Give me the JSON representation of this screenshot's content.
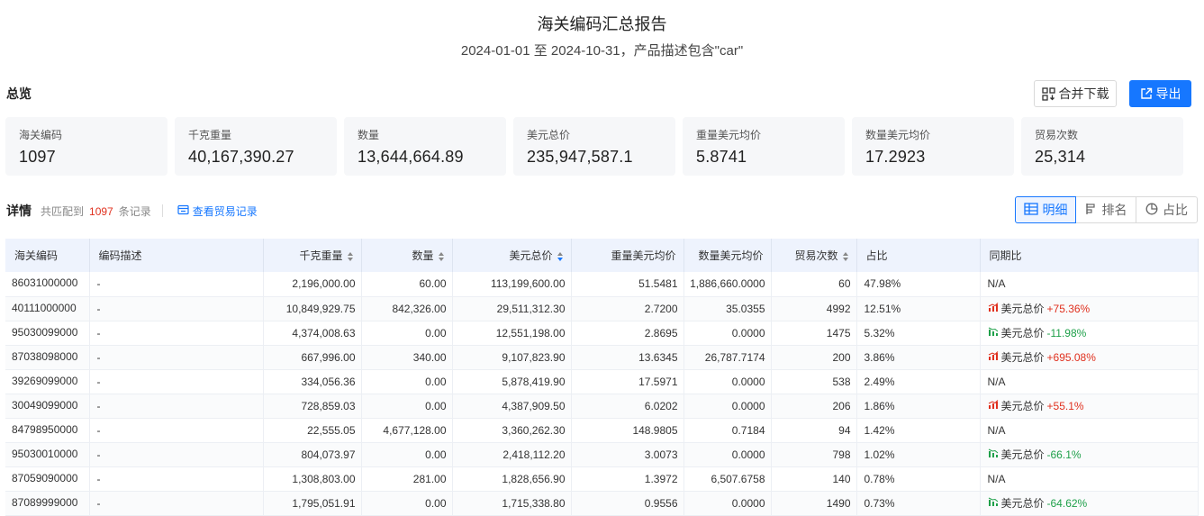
{
  "header": {
    "title": "海关编码汇总报告",
    "subtitle": "2024-01-01 至 2024-10-31，产品描述包含\"car\""
  },
  "overview": {
    "title": "总览",
    "merge_download_label": "合并下载",
    "export_label": "导出",
    "cards": [
      {
        "label": "海关编码",
        "value": "1097"
      },
      {
        "label": "千克重量",
        "value": "40,167,390.27"
      },
      {
        "label": "数量",
        "value": "13,644,664.89"
      },
      {
        "label": "美元总价",
        "value": "235,947,587.1"
      },
      {
        "label": "重量美元均价",
        "value": "5.8741"
      },
      {
        "label": "数量美元均价",
        "value": "17.2923"
      },
      {
        "label": "贸易次数",
        "value": "25,314"
      }
    ]
  },
  "detail": {
    "title": "详情",
    "match_prefix": "共匹配到",
    "match_count": "1097",
    "match_suffix": "条记录",
    "view_trade_link": "查看贸易记录",
    "views": [
      {
        "label": "明细",
        "icon": "table-icon",
        "active": true
      },
      {
        "label": "排名",
        "icon": "ranking-icon",
        "active": false
      },
      {
        "label": "占比",
        "icon": "pie-icon",
        "active": false
      }
    ]
  },
  "table": {
    "columns": [
      "海关编码",
      "编码描述",
      "千克重量",
      "数量",
      "美元总价",
      "重量美元均价",
      "数量美元均价",
      "贸易次数",
      "占比",
      "同期比"
    ],
    "up_color": "#e0301e",
    "down_color": "#1fa04a",
    "rows": [
      {
        "code": "86031000000",
        "desc": "-",
        "weight": "2,196,000.00",
        "qty": "60.00",
        "usd": "113,199,600.00",
        "wavg": "51.5481",
        "qavg": "1,886,660.0000",
        "trades": "60",
        "ratio": "47.98%",
        "yoy_label": "",
        "yoy_value": "",
        "yoy_text": "N/A",
        "trend": "none"
      },
      {
        "code": "40111000000",
        "desc": "-",
        "weight": "10,849,929.75",
        "qty": "842,326.00",
        "usd": "29,511,312.30",
        "wavg": "2.7200",
        "qavg": "35.0355",
        "trades": "4992",
        "ratio": "12.51%",
        "yoy_label": "美元总价",
        "yoy_value": "+75.36%",
        "yoy_text": "",
        "trend": "up"
      },
      {
        "code": "95030099000",
        "desc": "-",
        "weight": "4,374,008.63",
        "qty": "0.00",
        "usd": "12,551,198.00",
        "wavg": "2.8695",
        "qavg": "0.0000",
        "trades": "1475",
        "ratio": "5.32%",
        "yoy_label": "美元总价",
        "yoy_value": "-11.98%",
        "yoy_text": "",
        "trend": "down"
      },
      {
        "code": "87038098000",
        "desc": "-",
        "weight": "667,996.00",
        "qty": "340.00",
        "usd": "9,107,823.90",
        "wavg": "13.6345",
        "qavg": "26,787.7174",
        "trades": "200",
        "ratio": "3.86%",
        "yoy_label": "美元总价",
        "yoy_value": "+695.08%",
        "yoy_text": "",
        "trend": "up"
      },
      {
        "code": "39269099000",
        "desc": "-",
        "weight": "334,056.36",
        "qty": "0.00",
        "usd": "5,878,419.90",
        "wavg": "17.5971",
        "qavg": "0.0000",
        "trades": "538",
        "ratio": "2.49%",
        "yoy_label": "",
        "yoy_value": "",
        "yoy_text": "N/A",
        "trend": "none"
      },
      {
        "code": "30049099000",
        "desc": "-",
        "weight": "728,859.03",
        "qty": "0.00",
        "usd": "4,387,909.50",
        "wavg": "6.0202",
        "qavg": "0.0000",
        "trades": "206",
        "ratio": "1.86%",
        "yoy_label": "美元总价",
        "yoy_value": "+55.1%",
        "yoy_text": "",
        "trend": "up"
      },
      {
        "code": "84798950000",
        "desc": "-",
        "weight": "22,555.05",
        "qty": "4,677,128.00",
        "usd": "3,360,262.30",
        "wavg": "148.9805",
        "qavg": "0.7184",
        "trades": "94",
        "ratio": "1.42%",
        "yoy_label": "",
        "yoy_value": "",
        "yoy_text": "N/A",
        "trend": "none"
      },
      {
        "code": "95030010000",
        "desc": "-",
        "weight": "804,073.97",
        "qty": "0.00",
        "usd": "2,418,112.20",
        "wavg": "3.0073",
        "qavg": "0.0000",
        "trades": "798",
        "ratio": "1.02%",
        "yoy_label": "美元总价",
        "yoy_value": "-66.1%",
        "yoy_text": "",
        "trend": "down"
      },
      {
        "code": "87059090000",
        "desc": "-",
        "weight": "1,308,803.00",
        "qty": "281.00",
        "usd": "1,828,656.90",
        "wavg": "1.3972",
        "qavg": "6,507.6758",
        "trades": "140",
        "ratio": "0.78%",
        "yoy_label": "",
        "yoy_value": "",
        "yoy_text": "N/A",
        "trend": "none"
      },
      {
        "code": "87089999000",
        "desc": "-",
        "weight": "1,795,051.91",
        "qty": "0.00",
        "usd": "1,715,338.80",
        "wavg": "0.9556",
        "qavg": "0.0000",
        "trades": "1490",
        "ratio": "0.73%",
        "yoy_label": "美元总价",
        "yoy_value": "-64.62%",
        "yoy_text": "",
        "trend": "down"
      }
    ]
  }
}
